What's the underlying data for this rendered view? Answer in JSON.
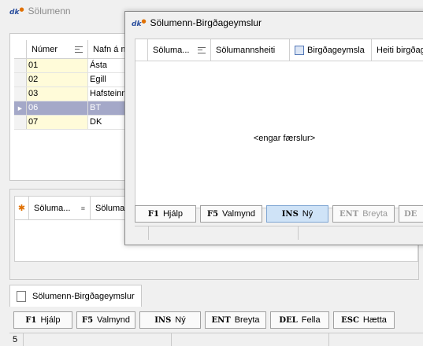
{
  "back_window": {
    "logo": "dk",
    "title": "Sölumenn",
    "grid": {
      "columns": [
        "Númer",
        "Nafn á m"
      ],
      "rows": [
        {
          "number": "01",
          "name": "Ásta",
          "selected": false
        },
        {
          "number": "02",
          "name": "Egill",
          "selected": false
        },
        {
          "number": "03",
          "name": "Hafsteinn",
          "selected": false
        },
        {
          "number": "06",
          "name": "BT",
          "selected": true
        },
        {
          "number": "07",
          "name": "DK",
          "selected": false
        }
      ]
    },
    "sub_grid": {
      "columns": [
        "Söluma...",
        "Sölumar"
      ]
    },
    "tab": {
      "label": "Sölumenn-Birgðageymslur"
    },
    "buttons": [
      {
        "key": "F1",
        "label": "Hjálp"
      },
      {
        "key": "F5",
        "label": "Valmynd"
      },
      {
        "key": "INS",
        "label": "Ný"
      },
      {
        "key": "ENT",
        "label": "Breyta"
      },
      {
        "key": "DEL",
        "label": "Fella"
      },
      {
        "key": "ESC",
        "label": "Hætta"
      }
    ],
    "status": {
      "count": "5"
    }
  },
  "front_window": {
    "logo": "dk",
    "title": "Sölumenn-Birgðageymslur",
    "grid": {
      "columns": [
        "Söluma...",
        "Sölumannsheiti",
        "Birgðageymsla",
        "Heiti birgðage"
      ],
      "empty_message": "<engar færslur>"
    },
    "buttons": [
      {
        "key": "F1",
        "label": "Hjálp"
      },
      {
        "key": "F5",
        "label": "Valmynd"
      },
      {
        "key": "INS",
        "label": "Ný"
      },
      {
        "key": "ENT",
        "label": "Breyta"
      },
      {
        "key": "DE",
        "label": ""
      }
    ]
  }
}
